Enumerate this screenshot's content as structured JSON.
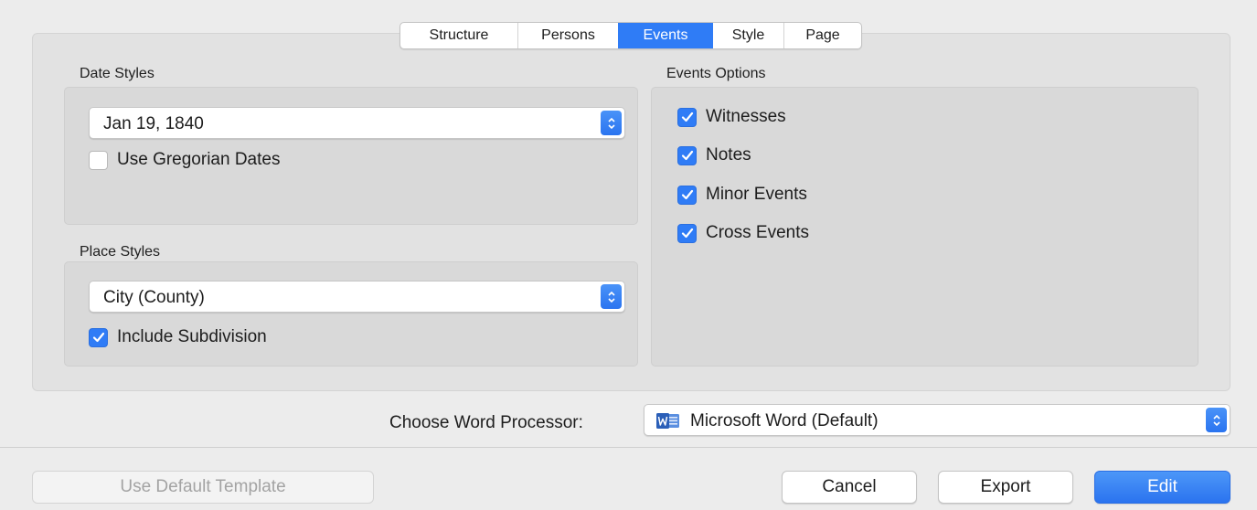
{
  "tabs": [
    {
      "label": "Structure",
      "active": false
    },
    {
      "label": "Persons",
      "active": false
    },
    {
      "label": "Events",
      "active": true
    },
    {
      "label": "Style",
      "active": false
    },
    {
      "label": "Page",
      "active": false
    }
  ],
  "date_styles": {
    "label": "Date Styles",
    "selected": "Jan 19, 1840",
    "use_gregorian": {
      "label": "Use Gregorian Dates",
      "checked": false
    }
  },
  "place_styles": {
    "label": "Place Styles",
    "selected": "City (County)",
    "include_subdivision": {
      "label": "Include Subdivision",
      "checked": true
    }
  },
  "events_options": {
    "label": "Events Options",
    "items": [
      {
        "label": "Witnesses",
        "checked": true
      },
      {
        "label": "Notes",
        "checked": true
      },
      {
        "label": "Minor Events",
        "checked": true
      },
      {
        "label": "Cross Events",
        "checked": true
      }
    ]
  },
  "word_processor": {
    "label": "Choose Word Processor:",
    "selected": "Microsoft Word (Default)",
    "icon": "microsoft-word-icon"
  },
  "buttons": {
    "use_default_template": "Use Default Template",
    "cancel": "Cancel",
    "export": "Export",
    "edit": "Edit"
  },
  "colors": {
    "accent": "#2f7cf6",
    "background": "#ececec",
    "panel": "#e2e2e2",
    "group_box": "#d9d9d9"
  }
}
